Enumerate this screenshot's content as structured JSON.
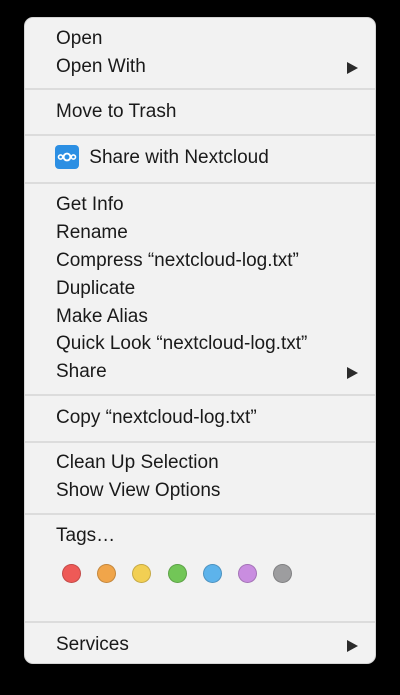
{
  "menu": {
    "group1": {
      "open": "Open",
      "open_with": "Open With"
    },
    "group2": {
      "move_to_trash": "Move to Trash"
    },
    "group3": {
      "share_nextcloud": "Share with Nextcloud",
      "share_nextcloud_icon": "nextcloud-icon"
    },
    "group4": {
      "get_info": "Get Info",
      "rename": "Rename",
      "compress": "Compress “nextcloud-log.txt”",
      "duplicate": "Duplicate",
      "make_alias": "Make Alias",
      "quick_look": "Quick Look “nextcloud-log.txt”",
      "share": "Share"
    },
    "group5": {
      "copy": "Copy “nextcloud-log.txt”"
    },
    "group6": {
      "clean_up": "Clean Up Selection",
      "view_options": "Show View Options"
    },
    "tags": {
      "label": "Tags…",
      "colors": [
        "#ee5a57",
        "#f0a54a",
        "#f2cf53",
        "#72c657",
        "#5db3eb",
        "#c98de0",
        "#9d9d9f"
      ],
      "color_names": [
        "Red",
        "Orange",
        "Yellow",
        "Green",
        "Blue",
        "Purple",
        "Gray"
      ]
    },
    "services": {
      "label": "Services"
    }
  }
}
